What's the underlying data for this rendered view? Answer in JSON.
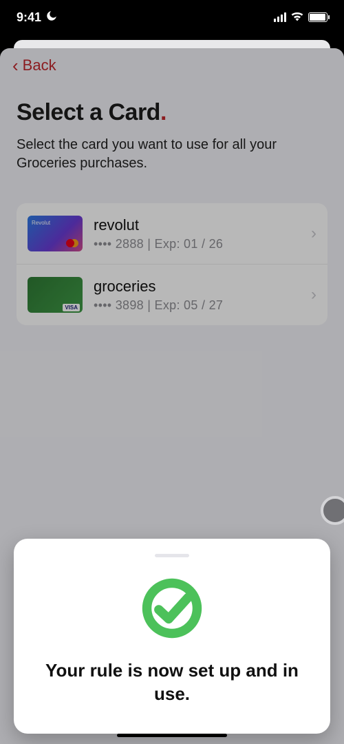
{
  "status": {
    "time": "9:41"
  },
  "nav": {
    "back_label": "Back"
  },
  "header": {
    "title_main": "Select a Card",
    "title_dot": ".",
    "subtitle": "Select the card you want to use for all your Groceries purchases."
  },
  "cards": [
    {
      "name": "revolut",
      "masked": "•••• 2888 | Exp: 01 / 26",
      "art": "revolut"
    },
    {
      "name": "groceries",
      "masked": "•••• 3898 | Exp: 05 / 27",
      "art": "groceries"
    }
  ],
  "modal": {
    "message": "Your rule is now set up and in use."
  }
}
